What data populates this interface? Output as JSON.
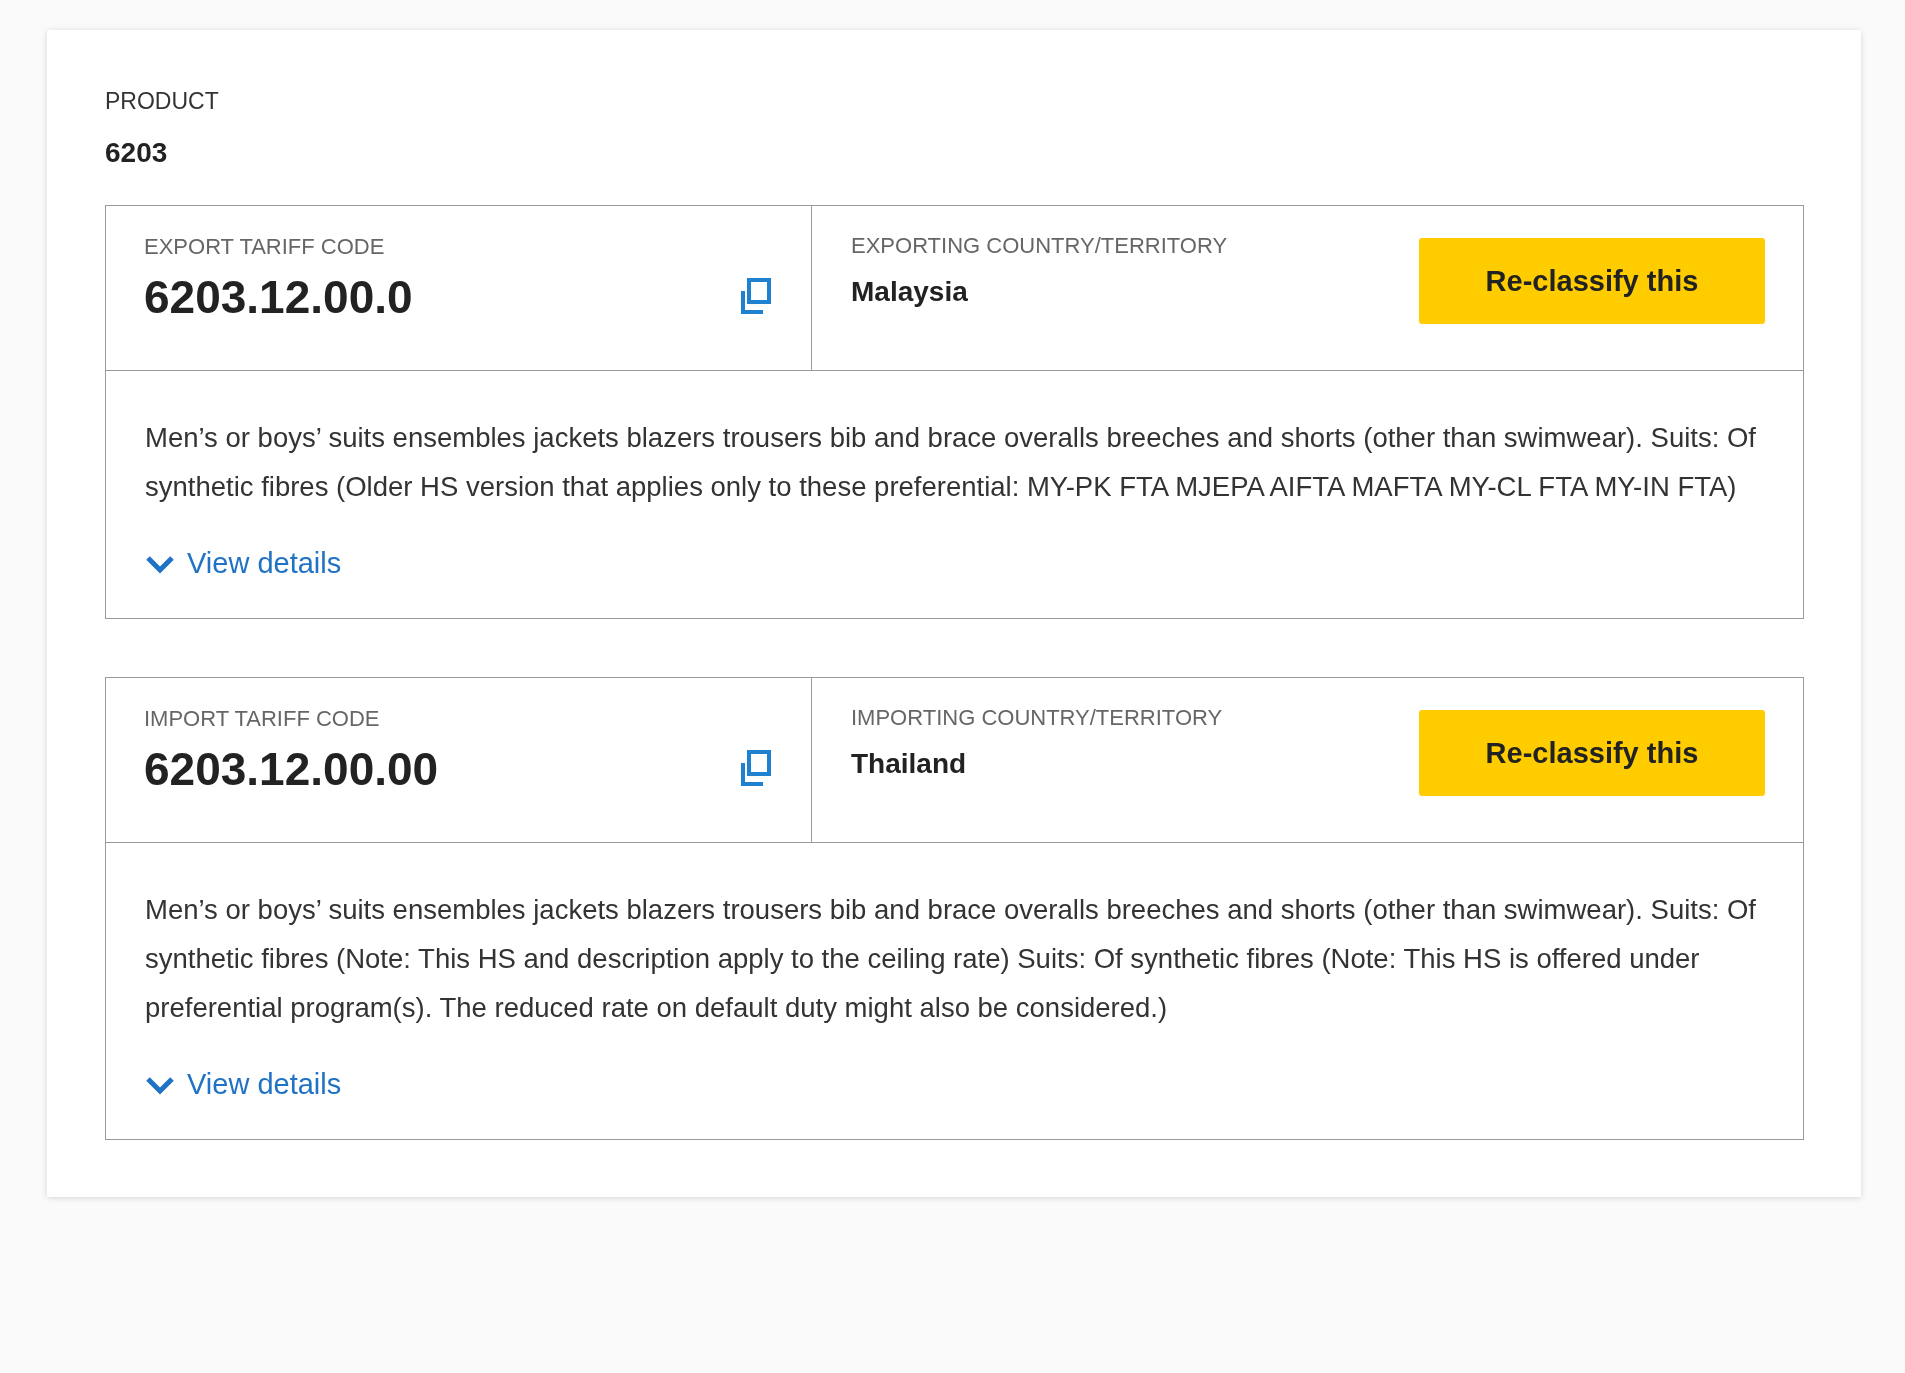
{
  "product": {
    "label": "PRODUCT",
    "value": "6203"
  },
  "tariffs": [
    {
      "code_label": "EXPORT TARIFF CODE",
      "code": "6203.12.00.0",
      "country_label": "EXPORTING COUNTRY/TERRITORY",
      "country": "Malaysia",
      "button": "Re-classify this",
      "description": "Men’s or boys’ suits ensembles jackets blazers trousers bib and brace overalls breeches and shorts (other than swimwear). Suits: Of synthetic fibres (Older HS version that applies only to these preferential: MY-PK FTA MJEPA AIFTA MAFTA MY-CL FTA MY-IN FTA)",
      "details_link": "View details",
      "expanded": false
    },
    {
      "code_label": "IMPORT TARIFF CODE",
      "code": "6203.12.00.00",
      "country_label": "IMPORTING COUNTRY/TERRITORY",
      "country": "Thailand",
      "button": "Re-classify this",
      "description": "Men’s or boys’ suits ensembles jackets blazers trousers bib and brace overalls breeches and shorts (other than swimwear). Suits: Of synthetic fibres (Note: This HS and description apply to the ceiling rate) Suits: Of synthetic fibres (Note: This HS is offered under preferential program(s). The reduced rate on default duty might also be considered.)",
      "details_link": "View details",
      "expanded": false
    }
  ]
}
